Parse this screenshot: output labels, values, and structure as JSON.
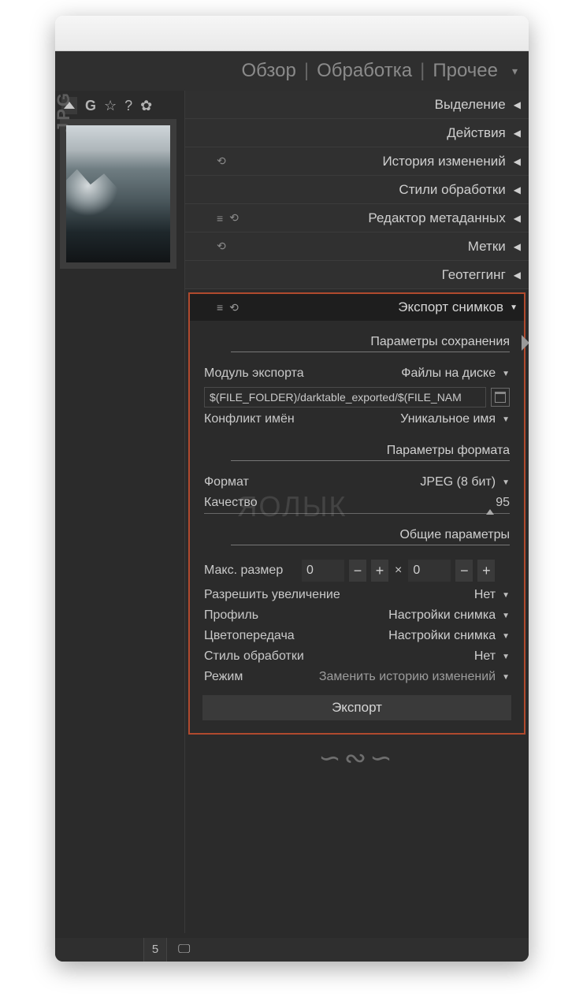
{
  "header": {
    "tabs": [
      "Обзор",
      "Обработка",
      "Прочее"
    ]
  },
  "left": {
    "jpg_badge": "JPG",
    "count": "5"
  },
  "sections": [
    {
      "title": "Выделение",
      "icons": []
    },
    {
      "title": "Действия",
      "icons": []
    },
    {
      "title": "История изменений",
      "icons": [
        "reset"
      ]
    },
    {
      "title": "Стили обработки",
      "icons": []
    },
    {
      "title": "Редактор метаданных",
      "icons": [
        "menu",
        "reset"
      ]
    },
    {
      "title": "Метки",
      "icons": [
        "reset"
      ]
    },
    {
      "title": "Геотеггинг",
      "icons": []
    }
  ],
  "export": {
    "header": "Экспорт снимков",
    "sub_storage": "Параметры сохранения",
    "module_label": "Модуль экспорта",
    "module_value": "Файлы на диске",
    "path": "$(FILE_FOLDER)/darktable_exported/$(FILE_NAM",
    "conflict_label": "Конфликт имён",
    "conflict_value": "Уникальное имя",
    "sub_format": "Параметры формата",
    "format_label": "Формат",
    "format_value": "JPEG (8 бит)",
    "quality_label": "Качество",
    "quality_value": "95",
    "sub_general": "Общие параметры",
    "size_label": "Макс. размер",
    "size_w": "0",
    "size_h": "0",
    "times": "×",
    "allow_upscale_label": "Разрешить увеличение",
    "allow_upscale_value": "Нет",
    "profile_label": "Профиль",
    "profile_value": "Настройки снимка",
    "intent_label": "Цветопередача",
    "intent_value": "Настройки снимка",
    "style_label": "Стиль обработки",
    "style_value": "Нет",
    "mode_label": "Режим",
    "mode_value": "Заменить историю изменений",
    "button": "Экспорт"
  },
  "watermark": "ЯОЛЫК"
}
